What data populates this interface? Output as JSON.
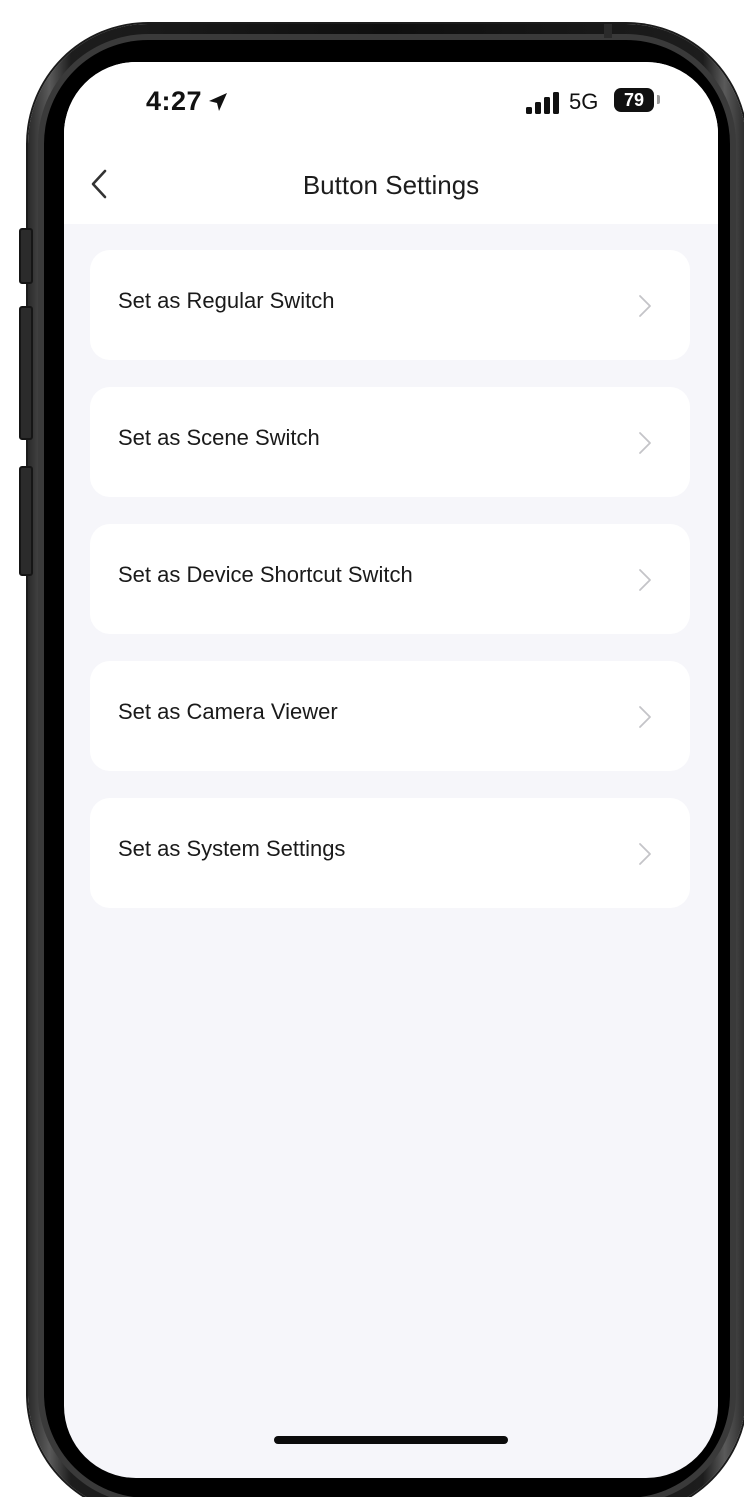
{
  "status_bar": {
    "time": "4:27",
    "location_icon": "location-arrow-icon",
    "signal_icon": "cellular-signal-icon",
    "network": "5G",
    "battery": "79"
  },
  "header": {
    "back_icon": "chevron-left-icon",
    "title": "Button Settings"
  },
  "menu": {
    "items": [
      {
        "label": "Set as Regular Switch"
      },
      {
        "label": "Set as Scene Switch"
      },
      {
        "label": "Set as Device Shortcut Switch"
      },
      {
        "label": "Set as Camera Viewer"
      },
      {
        "label": "Set as System Settings"
      }
    ],
    "chevron_icon": "chevron-right-icon"
  },
  "colors": {
    "background": "#f6f6fa",
    "card": "#ffffff",
    "text": "#1a1a1a",
    "chevron": "#c4c4c8"
  }
}
